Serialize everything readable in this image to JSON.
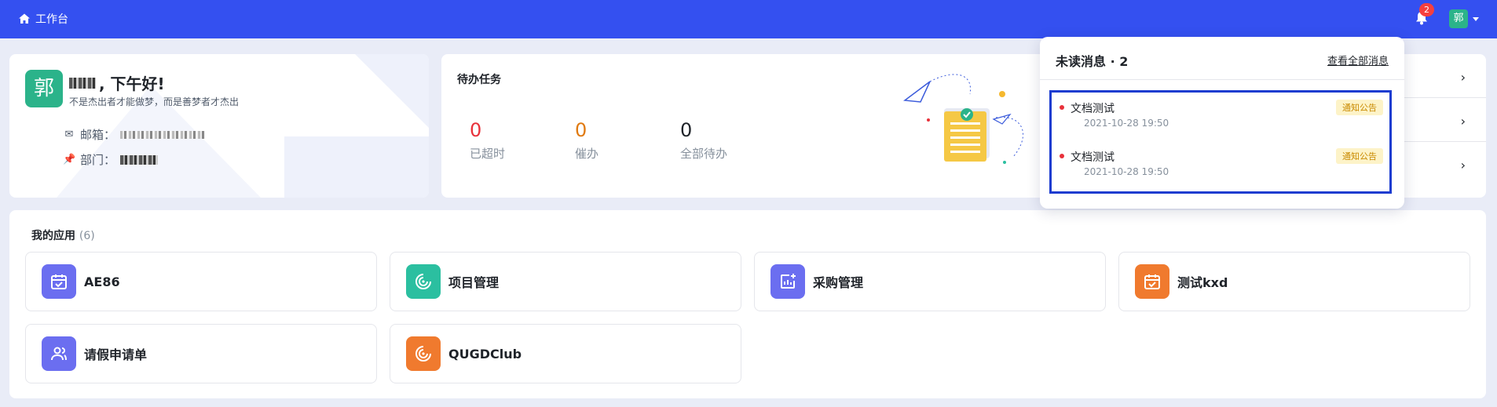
{
  "topbar": {
    "home_label": "工作台",
    "notification_count": "2",
    "user_initial": "郭",
    "accent": "#3450f0"
  },
  "profile": {
    "avatar_initial": "郭",
    "greeting": ", 下午好!",
    "motto": "不是杰出者才能做梦，而是善梦者才杰出",
    "email_label": "邮箱：",
    "dept_label": "部门："
  },
  "todo": {
    "title": "待办任务",
    "stats": [
      {
        "value": "0",
        "label": "已超时",
        "color": "#e8313a"
      },
      {
        "value": "0",
        "label": "催办",
        "color": "#e07a10"
      },
      {
        "value": "0",
        "label": "全部待办",
        "color": "#1f2329"
      }
    ]
  },
  "apps": {
    "title": "我的应用",
    "count": "(6)",
    "items": [
      {
        "name": "AE86",
        "icon": "calendar-icon",
        "color": "#6b6ef0"
      },
      {
        "name": "项目管理",
        "icon": "radar-icon",
        "color": "#2bbfa0"
      },
      {
        "name": "采购管理",
        "icon": "chart-add-icon",
        "color": "#6b6ef0"
      },
      {
        "name": "测试kxd",
        "icon": "calendar-icon",
        "color": "#f07a2e"
      },
      {
        "name": "请假申请单",
        "icon": "users-icon",
        "color": "#6b6ef0"
      },
      {
        "name": "QUGDClub",
        "icon": "radar-icon",
        "color": "#f07a2e"
      }
    ]
  },
  "notifications": {
    "title": "未读消息 · 2",
    "view_all": "查看全部消息",
    "items": [
      {
        "title": "文档测试",
        "time": "2021-10-28 19:50",
        "tag": "通知公告"
      },
      {
        "title": "文档测试",
        "time": "2021-10-28 19:50",
        "tag": "通知公告"
      }
    ]
  }
}
